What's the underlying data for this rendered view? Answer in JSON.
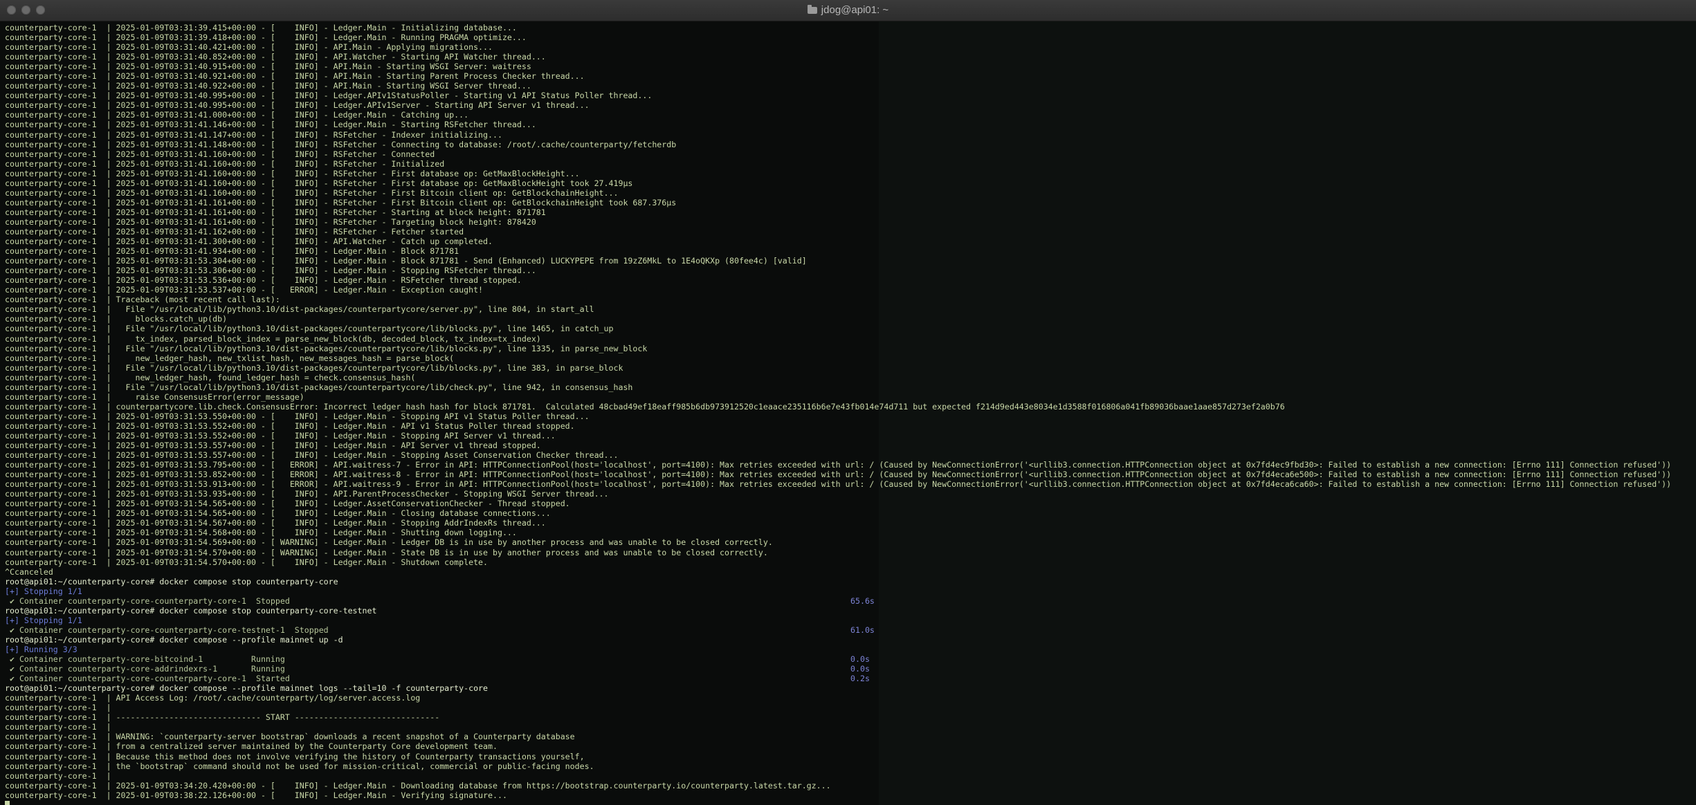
{
  "window": {
    "title": "jdog@api01: ~"
  },
  "lines": [
    {
      "t": "counterparty-core-1  | 2025-01-09T03:31:39.415+00:00 - [    INFO] - Ledger.Main - Initializing database..."
    },
    {
      "t": "counterparty-core-1  | 2025-01-09T03:31:39.418+00:00 - [    INFO] - Ledger.Main - Running PRAGMA optimize..."
    },
    {
      "t": "counterparty-core-1  | 2025-01-09T03:31:40.421+00:00 - [    INFO] - API.Main - Applying migrations..."
    },
    {
      "t": "counterparty-core-1  | 2025-01-09T03:31:40.852+00:00 - [    INFO] - API.Watcher - Starting API Watcher thread..."
    },
    {
      "t": "counterparty-core-1  | 2025-01-09T03:31:40.915+00:00 - [    INFO] - API.Main - Starting WSGI Server: waitress"
    },
    {
      "t": "counterparty-core-1  | 2025-01-09T03:31:40.921+00:00 - [    INFO] - API.Main - Starting Parent Process Checker thread..."
    },
    {
      "t": "counterparty-core-1  | 2025-01-09T03:31:40.922+00:00 - [    INFO] - API.Main - Starting WSGI Server thread..."
    },
    {
      "t": "counterparty-core-1  | 2025-01-09T03:31:40.995+00:00 - [    INFO] - Ledger.APIv1StatusPoller - Starting v1 API Status Poller thread..."
    },
    {
      "t": "counterparty-core-1  | 2025-01-09T03:31:40.995+00:00 - [    INFO] - Ledger.APIv1Server - Starting API Server v1 thread..."
    },
    {
      "t": "counterparty-core-1  | 2025-01-09T03:31:41.000+00:00 - [    INFO] - Ledger.Main - Catching up..."
    },
    {
      "t": "counterparty-core-1  | 2025-01-09T03:31:41.146+00:00 - [    INFO] - Ledger.Main - Starting RSFetcher thread..."
    },
    {
      "t": "counterparty-core-1  | 2025-01-09T03:31:41.147+00:00 - [    INFO] - RSFetcher - Indexer initializing..."
    },
    {
      "t": "counterparty-core-1  | 2025-01-09T03:31:41.148+00:00 - [    INFO] - RSFetcher - Connecting to database: /root/.cache/counterparty/fetcherdb"
    },
    {
      "t": "counterparty-core-1  | 2025-01-09T03:31:41.160+00:00 - [    INFO] - RSFetcher - Connected"
    },
    {
      "t": "counterparty-core-1  | 2025-01-09T03:31:41.160+00:00 - [    INFO] - RSFetcher - Initialized"
    },
    {
      "t": "counterparty-core-1  | 2025-01-09T03:31:41.160+00:00 - [    INFO] - RSFetcher - First database op: GetMaxBlockHeight..."
    },
    {
      "t": "counterparty-core-1  | 2025-01-09T03:31:41.160+00:00 - [    INFO] - RSFetcher - First database op: GetMaxBlockHeight took 27.419µs"
    },
    {
      "t": "counterparty-core-1  | 2025-01-09T03:31:41.160+00:00 - [    INFO] - RSFetcher - First Bitcoin client op: GetBlockchainHeight..."
    },
    {
      "t": "counterparty-core-1  | 2025-01-09T03:31:41.161+00:00 - [    INFO] - RSFetcher - First Bitcoin client op: GetBlockchainHeight took 687.376µs"
    },
    {
      "t": "counterparty-core-1  | 2025-01-09T03:31:41.161+00:00 - [    INFO] - RSFetcher - Starting at block height: 871781"
    },
    {
      "t": "counterparty-core-1  | 2025-01-09T03:31:41.161+00:00 - [    INFO] - RSFetcher - Targeting block height: 878420"
    },
    {
      "t": "counterparty-core-1  | 2025-01-09T03:31:41.162+00:00 - [    INFO] - RSFetcher - Fetcher started"
    },
    {
      "t": "counterparty-core-1  | 2025-01-09T03:31:41.300+00:00 - [    INFO] - API.Watcher - Catch up completed."
    },
    {
      "t": "counterparty-core-1  | 2025-01-09T03:31:41.934+00:00 - [    INFO] - Ledger.Main - Block 871781"
    },
    {
      "t": "counterparty-core-1  | 2025-01-09T03:31:53.304+00:00 - [    INFO] - Ledger.Main - Block 871781 - Send (Enhanced) LUCKYPEPE from 19zZ6MkL to 1E4oQKXp (80fee4c) [valid]"
    },
    {
      "t": "counterparty-core-1  | 2025-01-09T03:31:53.306+00:00 - [    INFO] - Ledger.Main - Stopping RSFetcher thread..."
    },
    {
      "t": "counterparty-core-1  | 2025-01-09T03:31:53.536+00:00 - [    INFO] - Ledger.Main - RSFetcher thread stopped."
    },
    {
      "t": "counterparty-core-1  | 2025-01-09T03:31:53.537+00:00 - [   ERROR] - Ledger.Main - Exception caught!"
    },
    {
      "t": "counterparty-core-1  | Traceback (most recent call last):"
    },
    {
      "t": "counterparty-core-1  |   File \"/usr/local/lib/python3.10/dist-packages/counterpartycore/server.py\", line 804, in start_all"
    },
    {
      "t": "counterparty-core-1  |     blocks.catch_up(db)"
    },
    {
      "t": "counterparty-core-1  |   File \"/usr/local/lib/python3.10/dist-packages/counterpartycore/lib/blocks.py\", line 1465, in catch_up"
    },
    {
      "t": "counterparty-core-1  |     tx_index, parsed_block_index = parse_new_block(db, decoded_block, tx_index=tx_index)"
    },
    {
      "t": "counterparty-core-1  |   File \"/usr/local/lib/python3.10/dist-packages/counterpartycore/lib/blocks.py\", line 1335, in parse_new_block"
    },
    {
      "t": "counterparty-core-1  |     new_ledger_hash, new_txlist_hash, new_messages_hash = parse_block("
    },
    {
      "t": "counterparty-core-1  |   File \"/usr/local/lib/python3.10/dist-packages/counterpartycore/lib/blocks.py\", line 383, in parse_block"
    },
    {
      "t": "counterparty-core-1  |     new_ledger_hash, found_ledger_hash = check.consensus_hash("
    },
    {
      "t": "counterparty-core-1  |   File \"/usr/local/lib/python3.10/dist-packages/counterpartycore/lib/check.py\", line 942, in consensus_hash"
    },
    {
      "t": "counterparty-core-1  |     raise ConsensusError(error_message)"
    },
    {
      "t": "counterparty-core-1  | counterpartycore.lib.check.ConsensusError: Incorrect ledger_hash hash for block 871781.  Calculated 48cbad49ef18eaff985b6db973912520c1eaace235116b6e7e43fb014e74d711 but expected f214d9ed443e8034e1d3588f016806a041fb89036baae1aae857d273ef2a0b76"
    },
    {
      "t": "counterparty-core-1  | 2025-01-09T03:31:53.550+00:00 - [    INFO] - Ledger.Main - Stopping API v1 Status Poller thread..."
    },
    {
      "t": "counterparty-core-1  | 2025-01-09T03:31:53.552+00:00 - [    INFO] - Ledger.Main - API v1 Status Poller thread stopped."
    },
    {
      "t": "counterparty-core-1  | 2025-01-09T03:31:53.552+00:00 - [    INFO] - Ledger.Main - Stopping API Server v1 thread..."
    },
    {
      "t": "counterparty-core-1  | 2025-01-09T03:31:53.557+00:00 - [    INFO] - Ledger.Main - API Server v1 thread stopped."
    },
    {
      "t": "counterparty-core-1  | 2025-01-09T03:31:53.557+00:00 - [    INFO] - Ledger.Main - Stopping Asset Conservation Checker thread..."
    },
    {
      "t": "counterparty-core-1  | 2025-01-09T03:31:53.795+00:00 - [   ERROR] - API.waitress-7 - Error in API: HTTPConnectionPool(host='localhost', port=4100): Max retries exceeded with url: / (Caused by NewConnectionError('<urllib3.connection.HTTPConnection object at 0x7fd4ec9fbd30>: Failed to establish a new connection: [Errno 111] Connection refused'))"
    },
    {
      "t": "counterparty-core-1  | 2025-01-09T03:31:53.852+00:00 - [   ERROR] - API.waitress-8 - Error in API: HTTPConnectionPool(host='localhost', port=4100): Max retries exceeded with url: / (Caused by NewConnectionError('<urllib3.connection.HTTPConnection object at 0x7fd4eca6e500>: Failed to establish a new connection: [Errno 111] Connection refused'))"
    },
    {
      "t": "counterparty-core-1  | 2025-01-09T03:31:53.913+00:00 - [   ERROR] - API.waitress-9 - Error in API: HTTPConnectionPool(host='localhost', port=4100): Max retries exceeded with url: / (Caused by NewConnectionError('<urllib3.connection.HTTPConnection object at 0x7fd4eca6ca60>: Failed to establish a new connection: [Errno 111] Connection refused'))"
    },
    {
      "t": "counterparty-core-1  | 2025-01-09T03:31:53.935+00:00 - [    INFO] - API.ParentProcessChecker - Stopping WSGI Server thread..."
    },
    {
      "t": "counterparty-core-1  | 2025-01-09T03:31:54.565+00:00 - [    INFO] - Ledger.AssetConservationChecker - Thread stopped."
    },
    {
      "t": "counterparty-core-1  | 2025-01-09T03:31:54.565+00:00 - [    INFO] - Ledger.Main - Closing database connections..."
    },
    {
      "t": "counterparty-core-1  | 2025-01-09T03:31:54.567+00:00 - [    INFO] - Ledger.Main - Stopping AddrIndexRs thread..."
    },
    {
      "t": "counterparty-core-1  | 2025-01-09T03:31:54.568+00:00 - [    INFO] - Ledger.Main - Shutting down logging..."
    },
    {
      "t": "counterparty-core-1  | 2025-01-09T03:31:54.569+00:00 - [ WARNING] - Ledger.Main - Ledger DB is in use by another process and was unable to be closed correctly."
    },
    {
      "t": "counterparty-core-1  | 2025-01-09T03:31:54.570+00:00 - [ WARNING] - Ledger.Main - State DB is in use by another process and was unable to be closed correctly."
    },
    {
      "t": "counterparty-core-1  | 2025-01-09T03:31:54.570+00:00 - [    INFO] - Ledger.Main - Shutdown complete."
    },
    {
      "t": "^Ccanceled"
    },
    {
      "t": "root@api01:~/counterparty-core# docker compose stop counterparty-core",
      "k": "prompt"
    },
    {
      "t": "[+] Stopping 1/1",
      "k": "blue"
    },
    {
      "t": " ✔ Container counterparty-core-counterparty-core-1  Stopped",
      "k": "green",
      "time": "65.6s"
    },
    {
      "t": "root@api01:~/counterparty-core# docker compose stop counterparty-core-testnet",
      "k": "prompt"
    },
    {
      "t": "[+] Stopping 1/1",
      "k": "blue"
    },
    {
      "t": " ✔ Container counterparty-core-counterparty-core-testnet-1  Stopped",
      "k": "green",
      "time": "61.0s"
    },
    {
      "t": "root@api01:~/counterparty-core# docker compose --profile mainnet up -d",
      "k": "prompt"
    },
    {
      "t": "[+] Running 3/3",
      "k": "blue"
    },
    {
      "t": " ✔ Container counterparty-core-bitcoind-1          Running",
      "k": "green",
      "time": "0.0s"
    },
    {
      "t": " ✔ Container counterparty-core-addrindexrs-1       Running",
      "k": "green",
      "time": "0.0s"
    },
    {
      "t": " ✔ Container counterparty-core-counterparty-core-1  Started",
      "k": "green",
      "time": "0.2s"
    },
    {
      "t": "root@api01:~/counterparty-core# docker compose --profile mainnet logs --tail=10 -f counterparty-core",
      "k": "prompt"
    },
    {
      "t": "counterparty-core-1  | API Access Log: /root/.cache/counterparty/log/server.access.log"
    },
    {
      "t": "counterparty-core-1  |"
    },
    {
      "t": "counterparty-core-1  | ------------------------------ START ------------------------------"
    },
    {
      "t": "counterparty-core-1  |"
    },
    {
      "t": "counterparty-core-1  | WARNING: `counterparty-server bootstrap` downloads a recent snapshot of a Counterparty database"
    },
    {
      "t": "counterparty-core-1  | from a centralized server maintained by the Counterparty Core development team."
    },
    {
      "t": "counterparty-core-1  | Because this method does not involve verifying the history of Counterparty transactions yourself,"
    },
    {
      "t": "counterparty-core-1  | the `bootstrap` command should not be used for mission-critical, commercial or public-facing nodes."
    },
    {
      "t": "counterparty-core-1  |"
    },
    {
      "t": "counterparty-core-1  | 2025-01-09T03:34:20.420+00:00 - [    INFO] - Ledger.Main - Downloading database from https://bootstrap.counterparty.io/counterparty.latest.tar.gz..."
    },
    {
      "t": "counterparty-core-1  | 2025-01-09T03:38:22.126+00:00 - [    INFO] - Ledger.Main - Verifying signature..."
    }
  ]
}
